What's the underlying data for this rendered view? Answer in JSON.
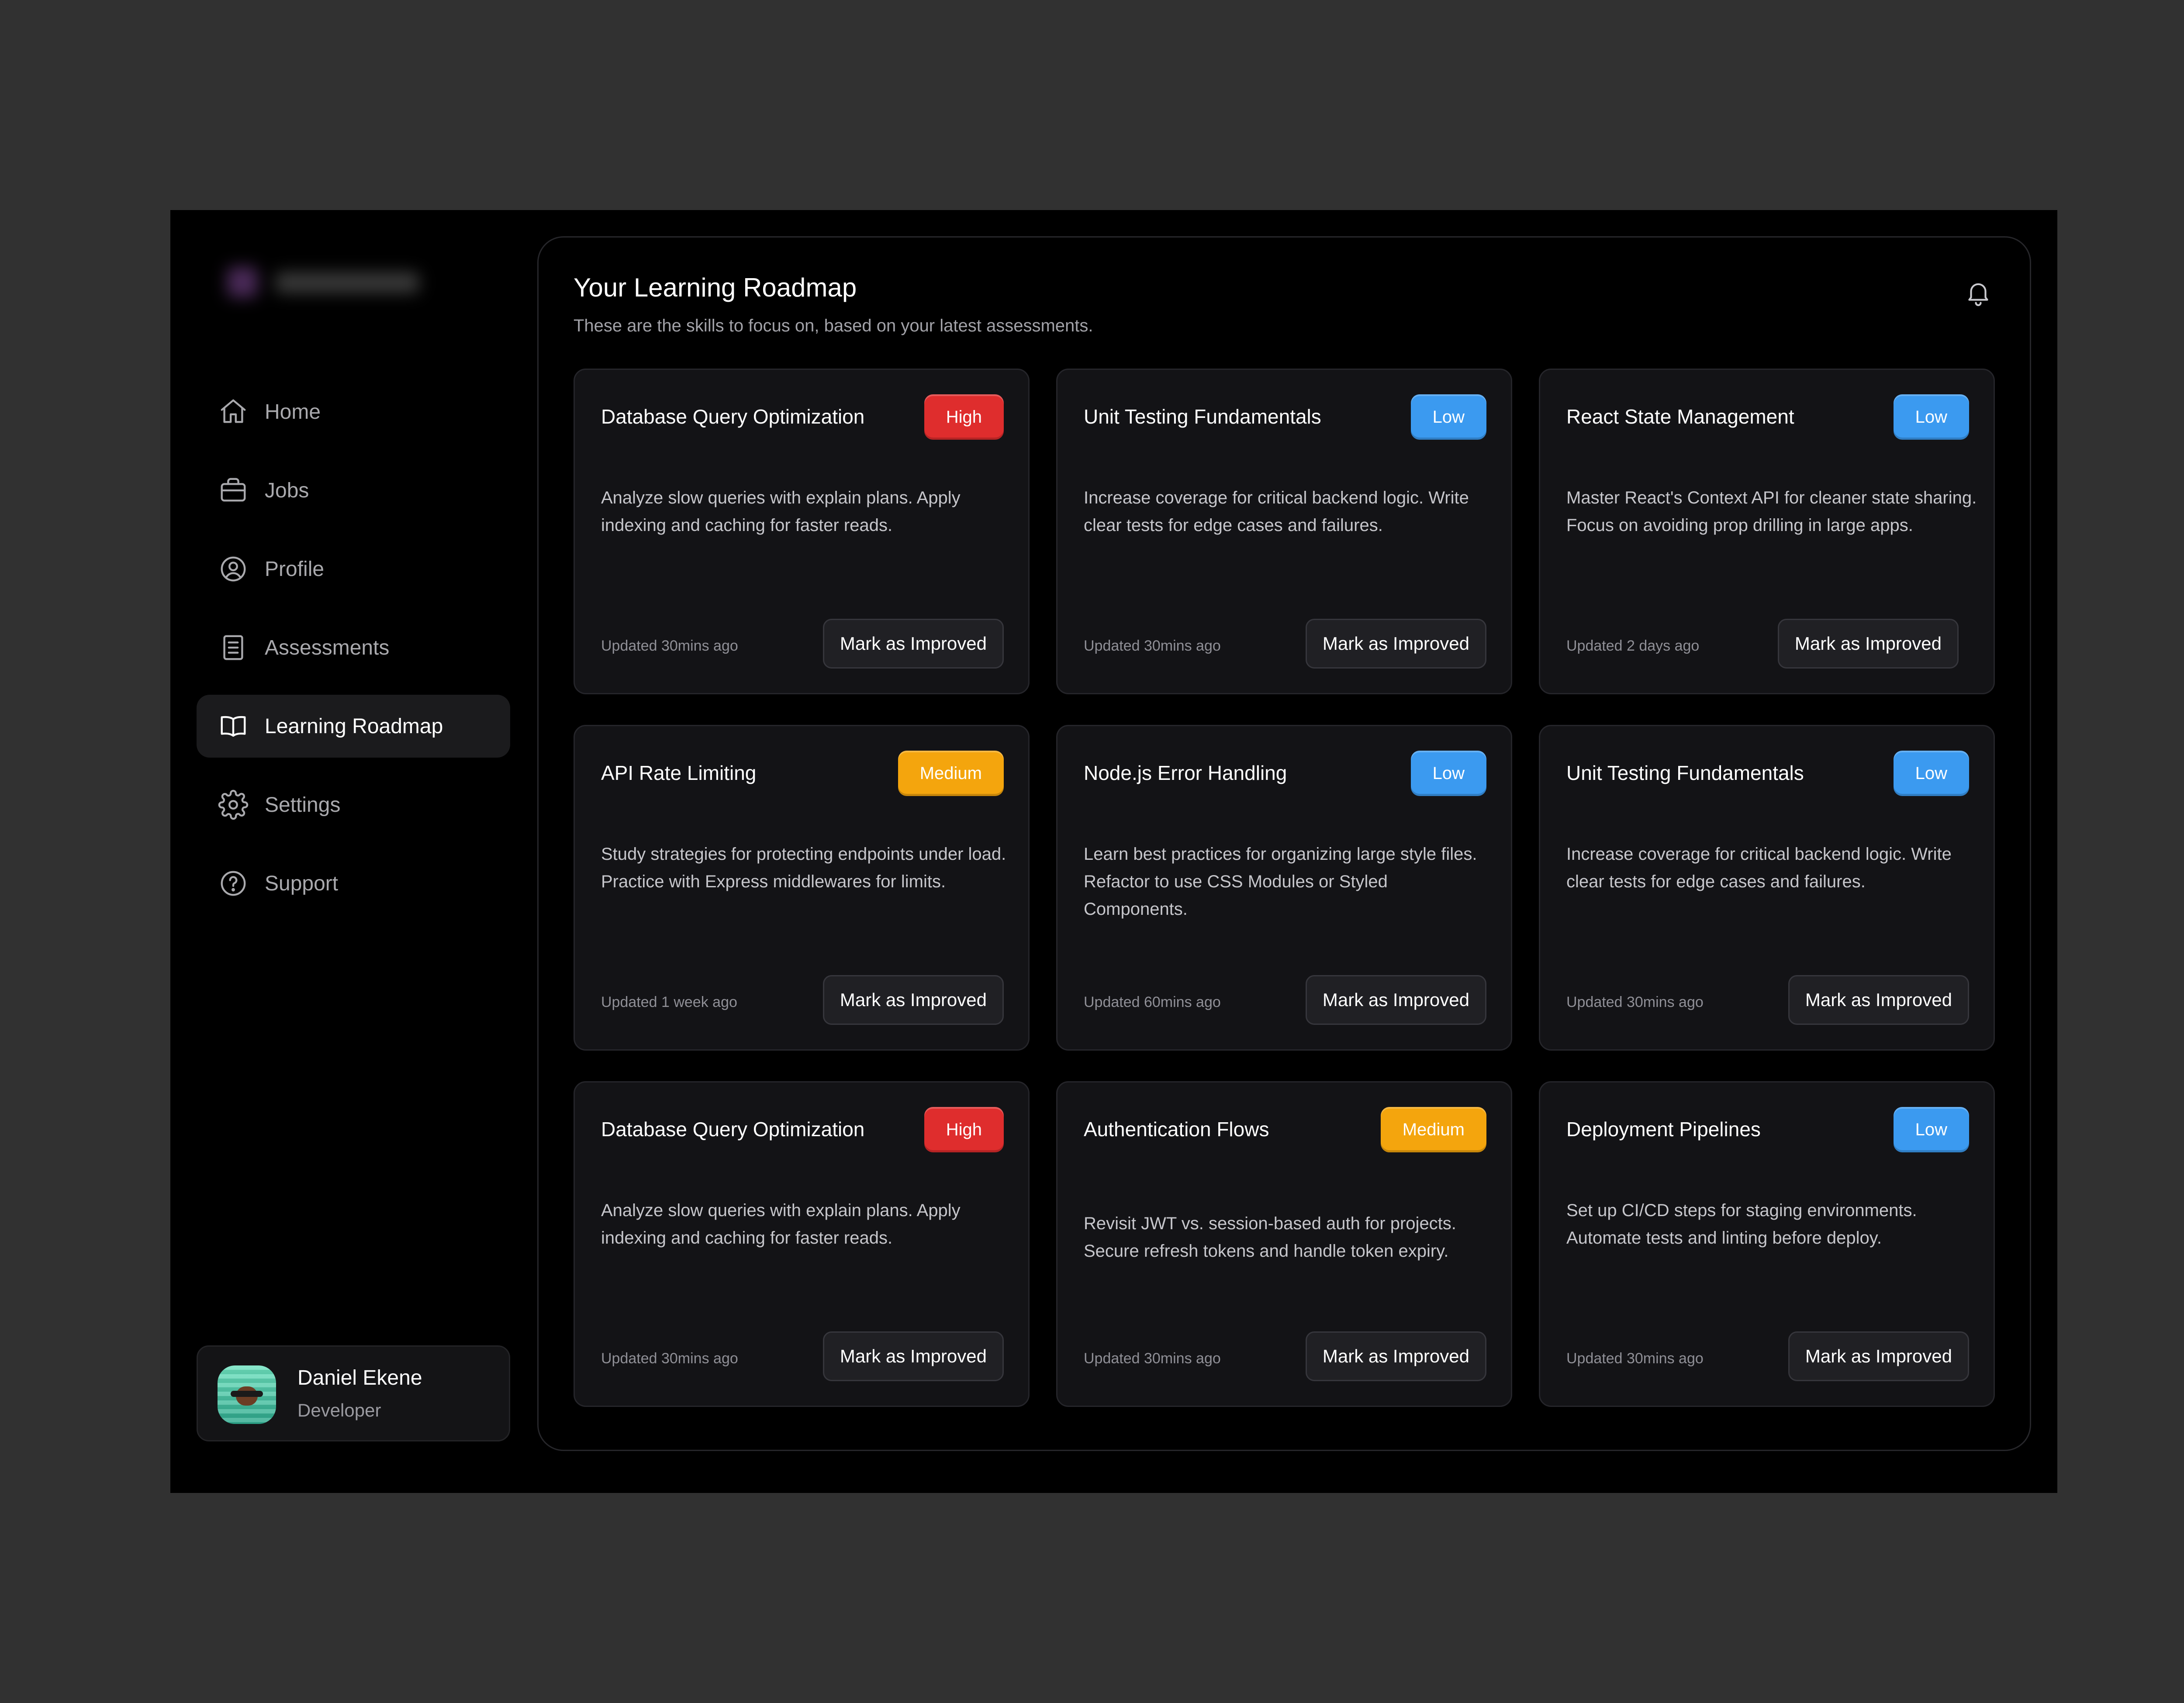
{
  "sidebar": {
    "nav": [
      {
        "label": "Home",
        "icon": "home-icon",
        "active": false
      },
      {
        "label": "Jobs",
        "icon": "briefcase-icon",
        "active": false
      },
      {
        "label": "Profile",
        "icon": "user-circle-icon",
        "active": false
      },
      {
        "label": "Assessments",
        "icon": "document-icon",
        "active": false
      },
      {
        "label": "Learning Roadmap",
        "icon": "book-open-icon",
        "active": true
      },
      {
        "label": "Settings",
        "icon": "gear-icon",
        "active": false
      },
      {
        "label": "Support",
        "icon": "help-circle-icon",
        "active": false
      }
    ],
    "user": {
      "name": "Daniel Ekene",
      "role": "Developer"
    }
  },
  "main": {
    "title": "Your Learning Roadmap",
    "subtitle": "These are the skills to focus on, based on your latest assessments.",
    "bell_icon": "bell-icon",
    "action_label": "Mark as Improved",
    "cards": [
      {
        "title": "Database Query Optimization",
        "priority": "High",
        "description": "Analyze slow queries with explain plans. Apply indexing and caching for faster reads.",
        "updated": "Updated 30mins ago"
      },
      {
        "title": "Unit Testing Fundamentals",
        "priority": "Low",
        "description": "Increase coverage for critical backend logic. Write clear tests for edge cases and failures.",
        "updated": "Updated 30mins ago"
      },
      {
        "title": "React State Management",
        "priority": "Low",
        "description": "Master React's Context API for cleaner state sharing. Focus on avoiding prop drilling in large apps.",
        "updated": "Updated 2 days ago"
      },
      {
        "title": "API Rate Limiting",
        "priority": "Medium",
        "description": "Study strategies for protecting endpoints under load. Practice with Express middlewares for limits.",
        "updated": "Updated 1 week ago"
      },
      {
        "title": "Node.js Error Handling",
        "priority": "Low",
        "description": "Learn best practices for organizing large style files. Refactor to use CSS Modules or Styled Components.",
        "updated": "Updated 60mins ago"
      },
      {
        "title": "Unit Testing Fundamentals",
        "priority": "Low",
        "description": "Increase coverage for critical backend logic. Write clear tests for edge cases and failures.",
        "updated": "Updated 30mins ago"
      },
      {
        "title": "Database Query Optimization",
        "priority": "High",
        "description": "Analyze slow queries with explain plans. Apply indexing and caching for faster reads.",
        "updated": "Updated 30mins ago"
      },
      {
        "title": "Authentication Flows",
        "priority": "Medium",
        "description": "Revisit JWT vs. session-based auth for projects. Secure refresh tokens and handle token expiry.",
        "updated": "Updated 30mins ago"
      },
      {
        "title": "Deployment Pipelines",
        "priority": "Low",
        "description": "Set up CI/CD steps for staging environments. Automate tests and linting before deploy.",
        "updated": "Updated 30mins ago"
      }
    ]
  },
  "colors": {
    "high": "#df2d2d",
    "medium": "#f4a50d",
    "low": "#3b9af0",
    "background": "#000000",
    "card": "#131316"
  }
}
